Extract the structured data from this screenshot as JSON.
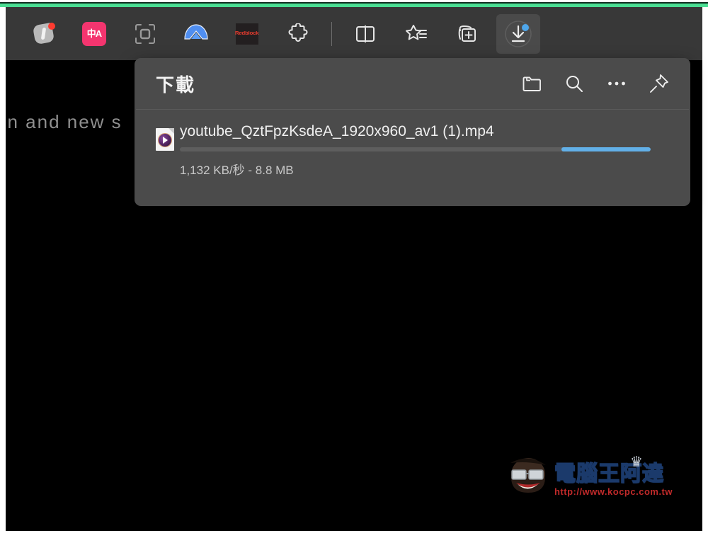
{
  "browser": {
    "toolbar": {
      "buttons": [
        {
          "name": "grammarly-extension-icon",
          "label": "Grammarly",
          "badge": "red"
        },
        {
          "name": "translate-extension-icon",
          "label": "中A",
          "badge": "none"
        },
        {
          "name": "screenshot-capture-icon",
          "label": "Screenshot",
          "badge": "none"
        },
        {
          "name": "nordvpn-extension-icon",
          "label": "NordVPN",
          "badge": "none"
        },
        {
          "name": "adblock-extension-icon",
          "label": "Redblock",
          "badge": "none"
        },
        {
          "name": "extensions-puzzle-icon",
          "label": "Extensions",
          "badge": "none"
        },
        {
          "name": "split-screen-icon",
          "label": "Split screen",
          "badge": "none"
        },
        {
          "name": "favorites-star-icon",
          "label": "Favorites",
          "badge": "none"
        },
        {
          "name": "collections-add-icon",
          "label": "Collections",
          "badge": "none"
        },
        {
          "name": "downloads-button",
          "label": "Downloads",
          "badge": "blue"
        }
      ]
    },
    "accent_color": "#4ade93",
    "toolbar_bg": "#383838"
  },
  "downloads_flyout": {
    "title": "下載",
    "header_actions": [
      {
        "name": "open-downloads-folder-button",
        "label": "開啟下載資料夾"
      },
      {
        "name": "search-downloads-button",
        "label": "搜尋下載項目"
      },
      {
        "name": "more-options-button",
        "label": "更多選項"
      },
      {
        "name": "pin-flyout-button",
        "label": "釘選"
      }
    ],
    "items": [
      {
        "file_name": "youtube_QztFpzKsdeA_1920x960_av1 (1).mp4",
        "status": "1,132 KB/秒 - 8.8 MB",
        "speed": "1,132 KB/秒",
        "size": "8.8 MB",
        "progress_state": "indeterminate",
        "progress_chunk_start_pct": 81,
        "progress_chunk_width_pct": 19,
        "progress_color": "#62b0e8",
        "file_type_icon": "media-file-icon"
      }
    ]
  },
  "page": {
    "visible_text": "on and new s",
    "background_color": "#000000"
  },
  "watermark": {
    "title": "電腦王阿達",
    "url": "http://www.kocpc.com.tw"
  }
}
